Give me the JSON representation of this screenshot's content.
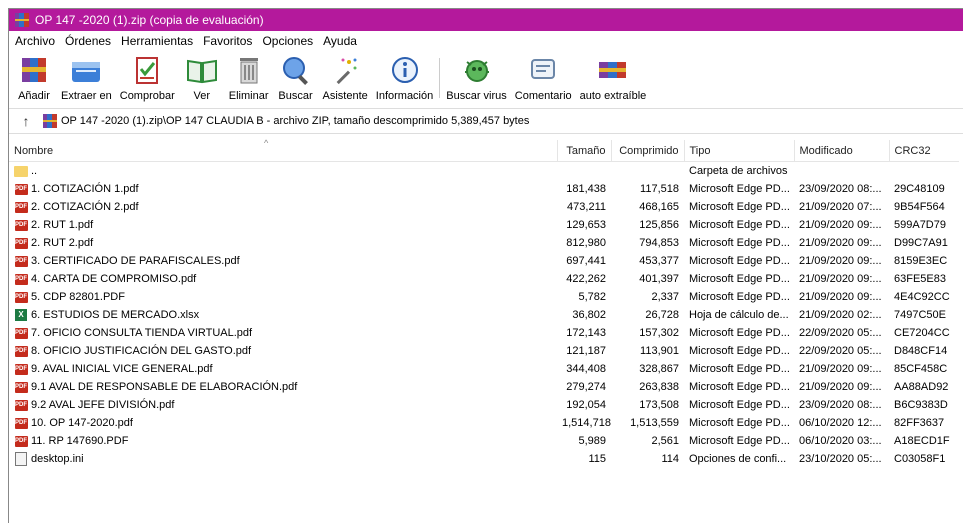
{
  "window": {
    "title": "OP 147 -2020 (1).zip (copia de evaluación)",
    "accent_color": "#b4199c"
  },
  "menu": [
    "Archivo",
    "Órdenes",
    "Herramientas",
    "Favoritos",
    "Opciones",
    "Ayuda"
  ],
  "toolbar": [
    {
      "label": "Añadir",
      "icon": "add-archive-icon"
    },
    {
      "label": "Extraer en",
      "icon": "extract-icon"
    },
    {
      "label": "Comprobar",
      "icon": "test-icon"
    },
    {
      "label": "Ver",
      "icon": "view-icon"
    },
    {
      "label": "Eliminar",
      "icon": "delete-icon"
    },
    {
      "label": "Buscar",
      "icon": "find-icon"
    },
    {
      "label": "Asistente",
      "icon": "wizard-icon"
    },
    {
      "label": "Información",
      "icon": "info-icon"
    },
    {
      "label": "Buscar virus",
      "icon": "virus-scan-icon"
    },
    {
      "label": "Comentario",
      "icon": "comment-icon"
    },
    {
      "label": "auto extraíble",
      "icon": "sfx-icon"
    }
  ],
  "address": {
    "path": "OP 147 -2020 (1).zip\\OP 147 CLAUDIA B - archivo ZIP, tamaño descomprimido 5,389,457 bytes"
  },
  "columns": {
    "name": "Nombre",
    "size": "Tamaño",
    "packed": "Comprimido",
    "type": "Tipo",
    "modified": "Modificado",
    "crc": "CRC32"
  },
  "files": [
    {
      "name": "..",
      "icon": "folder",
      "size": "",
      "packed": "",
      "type": "Carpeta de archivos",
      "modified": "",
      "crc": ""
    },
    {
      "name": "1. COTIZACIÓN 1.pdf",
      "icon": "pdf",
      "size": "181,438",
      "packed": "117,518",
      "type": "Microsoft Edge PD...",
      "modified": "23/09/2020 08:...",
      "crc": "29C48109"
    },
    {
      "name": "2. COTIZACIÓN 2.pdf",
      "icon": "pdf",
      "size": "473,211",
      "packed": "468,165",
      "type": "Microsoft Edge PD...",
      "modified": "21/09/2020 07:...",
      "crc": "9B54F564"
    },
    {
      "name": "2. RUT 1.pdf",
      "icon": "pdf",
      "size": "129,653",
      "packed": "125,856",
      "type": "Microsoft Edge PD...",
      "modified": "21/09/2020 09:...",
      "crc": "599A7D79"
    },
    {
      "name": "2. RUT 2.pdf",
      "icon": "pdf",
      "size": "812,980",
      "packed": "794,853",
      "type": "Microsoft Edge PD...",
      "modified": "21/09/2020 09:...",
      "crc": "D99C7A91"
    },
    {
      "name": "3. CERTIFICADO DE PARAFISCALES.pdf",
      "icon": "pdf",
      "size": "697,441",
      "packed": "453,377",
      "type": "Microsoft Edge PD...",
      "modified": "21/09/2020 09:...",
      "crc": "8159E3EC"
    },
    {
      "name": "4. CARTA DE COMPROMISO.pdf",
      "icon": "pdf",
      "size": "422,262",
      "packed": "401,397",
      "type": "Microsoft Edge PD...",
      "modified": "21/09/2020 09:...",
      "crc": "63FE5E83"
    },
    {
      "name": "5. CDP 82801.PDF",
      "icon": "pdf",
      "size": "5,782",
      "packed": "2,337",
      "type": "Microsoft Edge PD...",
      "modified": "21/09/2020 09:...",
      "crc": "4E4C92CC"
    },
    {
      "name": "6. ESTUDIOS DE MERCADO.xlsx",
      "icon": "xls",
      "size": "36,802",
      "packed": "26,728",
      "type": "Hoja de cálculo de...",
      "modified": "21/09/2020 02:...",
      "crc": "7497C50E"
    },
    {
      "name": "7. OFICIO CONSULTA TIENDA VIRTUAL.pdf",
      "icon": "pdf",
      "size": "172,143",
      "packed": "157,302",
      "type": "Microsoft Edge PD...",
      "modified": "22/09/2020 05:...",
      "crc": "CE7204CC"
    },
    {
      "name": "8. OFICIO JUSTIFICACIÓN DEL GASTO.pdf",
      "icon": "pdf",
      "size": "121,187",
      "packed": "113,901",
      "type": "Microsoft Edge PD...",
      "modified": "22/09/2020 05:...",
      "crc": "D848CF14"
    },
    {
      "name": "9. AVAL INICIAL VICE GENERAL.pdf",
      "icon": "pdf",
      "size": "344,408",
      "packed": "328,867",
      "type": "Microsoft Edge PD...",
      "modified": "21/09/2020 09:...",
      "crc": "85CF458C"
    },
    {
      "name": "9.1 AVAL DE RESPONSABLE DE ELABORACIÓN.pdf",
      "icon": "pdf",
      "size": "279,274",
      "packed": "263,838",
      "type": "Microsoft Edge PD...",
      "modified": "21/09/2020 09:...",
      "crc": "AA88AD92"
    },
    {
      "name": "9.2 AVAL JEFE DIVISIÓN.pdf",
      "icon": "pdf",
      "size": "192,054",
      "packed": "173,508",
      "type": "Microsoft Edge PD...",
      "modified": "23/09/2020 08:...",
      "crc": "B6C9383D"
    },
    {
      "name": "10. OP 147-2020.pdf",
      "icon": "pdf",
      "size": "1,514,718",
      "packed": "1,513,559",
      "type": "Microsoft Edge PD...",
      "modified": "06/10/2020 12:...",
      "crc": "82FF3637"
    },
    {
      "name": "11. RP 147690.PDF",
      "icon": "pdf",
      "size": "5,989",
      "packed": "2,561",
      "type": "Microsoft Edge PD...",
      "modified": "06/10/2020 03:...",
      "crc": "A18ECD1F"
    },
    {
      "name": "desktop.ini",
      "icon": "ini",
      "size": "115",
      "packed": "114",
      "type": "Opciones de confi...",
      "modified": "23/10/2020 05:...",
      "crc": "C03058F1"
    }
  ]
}
